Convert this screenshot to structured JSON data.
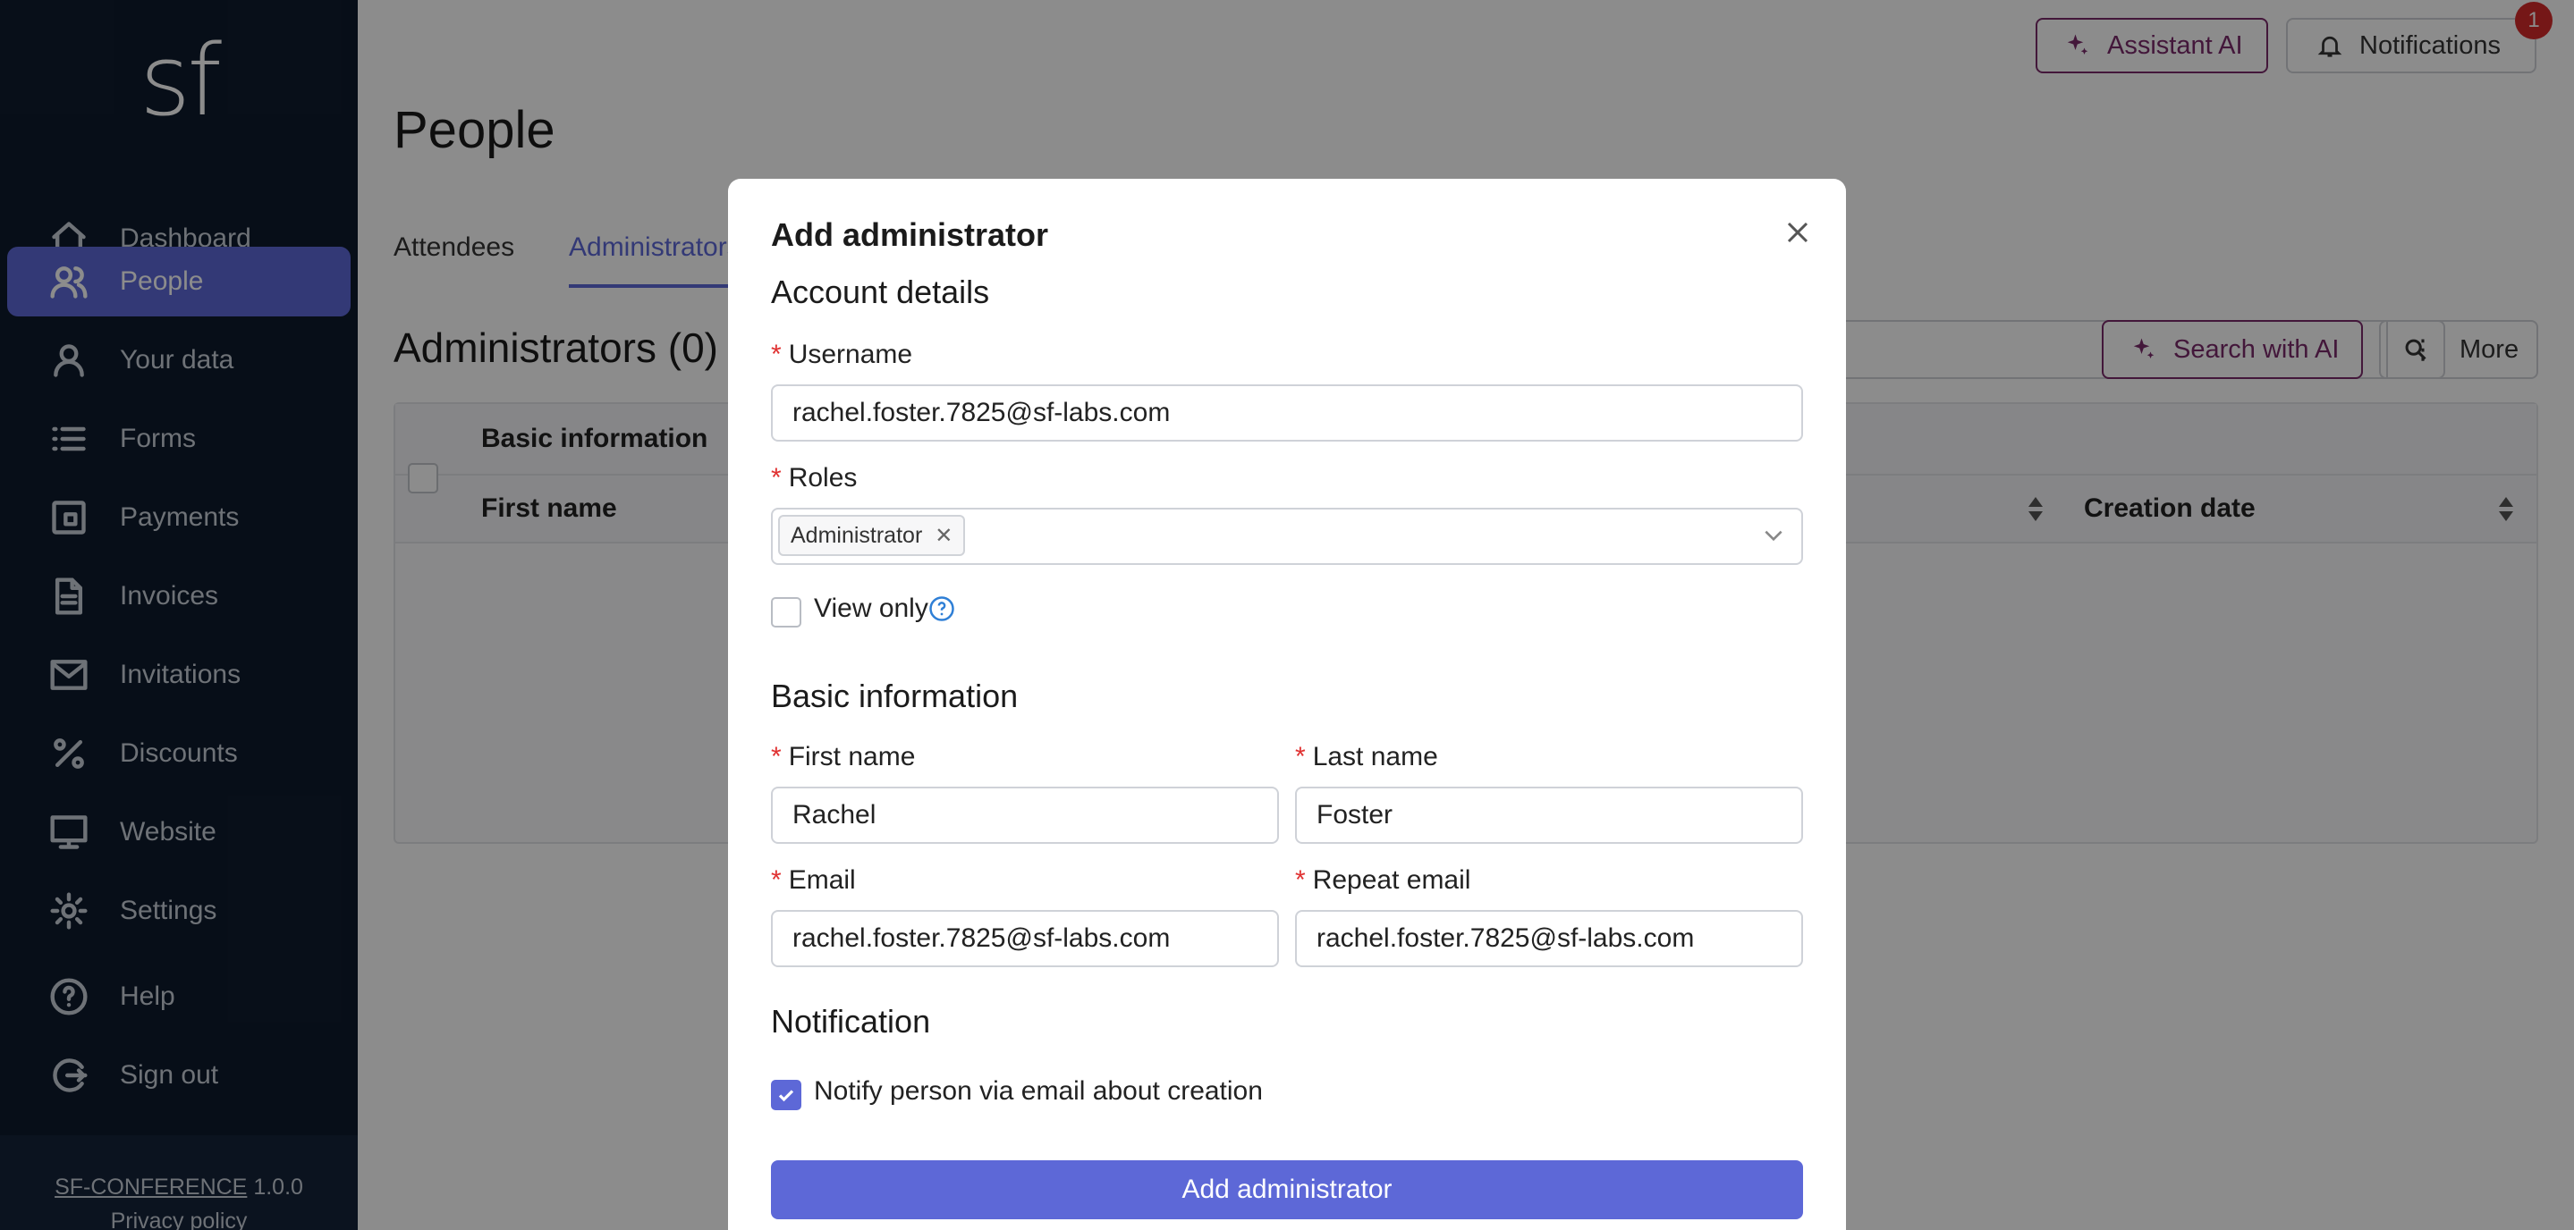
{
  "app": {
    "logo": "sf"
  },
  "sidebar": {
    "items": [
      {
        "label": "Dashboard",
        "icon": "home-icon"
      },
      {
        "label": "People",
        "icon": "people-icon",
        "active": true
      },
      {
        "label": "Your data",
        "icon": "user-icon"
      },
      {
        "label": "Forms",
        "icon": "list-icon"
      },
      {
        "label": "Payments",
        "icon": "wallet-icon"
      },
      {
        "label": "Invoices",
        "icon": "document-icon"
      },
      {
        "label": "Invitations",
        "icon": "mail-icon"
      },
      {
        "label": "Discounts",
        "icon": "percent-icon"
      },
      {
        "label": "Website",
        "icon": "monitor-icon"
      },
      {
        "label": "Settings",
        "icon": "gear-icon"
      },
      {
        "label": "Help",
        "icon": "help-icon"
      },
      {
        "label": "Sign out",
        "icon": "sign-out-icon"
      }
    ],
    "footer": {
      "product": "SF-CONFERENCE",
      "version": "1.0.0",
      "privacy": "Privacy policy"
    }
  },
  "header": {
    "assistant_label": "Assistant AI",
    "notifications_label": "Notifications",
    "notifications_count": "1"
  },
  "page": {
    "title": "People",
    "tabs": [
      {
        "label": "Attendees"
      },
      {
        "label": "Administrators"
      }
    ],
    "section_title": "Administrators (0)",
    "search_ai_label": "Search with AI",
    "more_label": "More",
    "table": {
      "group_header": "Basic information",
      "columns": {
        "first_name": "First name",
        "creation_date": "Creation date"
      }
    }
  },
  "modal": {
    "title": "Add administrator",
    "account_section": "Account details",
    "username": {
      "label": "Username",
      "value": "rachel.foster.7825@sf-labs.com"
    },
    "roles": {
      "label": "Roles",
      "tags": [
        "Administrator"
      ]
    },
    "view_only": {
      "label": "View only",
      "checked": false
    },
    "basic_section": "Basic information",
    "first_name": {
      "label": "First name",
      "value": "Rachel"
    },
    "last_name": {
      "label": "Last name",
      "value": "Foster"
    },
    "email": {
      "label": "Email",
      "value": "rachel.foster.7825@sf-labs.com"
    },
    "repeat_email": {
      "label": "Repeat email",
      "value": "rachel.foster.7825@sf-labs.com"
    },
    "notification_section": "Notification",
    "notify": {
      "label": "Notify person via email about creation",
      "checked": true
    },
    "submit_label": "Add administrator"
  },
  "colors": {
    "accent": "#5d68d7",
    "ai": "#7a2a6b",
    "sidebar": "#0e1b2d",
    "required": "#e03131",
    "badge": "#d62a2a"
  }
}
